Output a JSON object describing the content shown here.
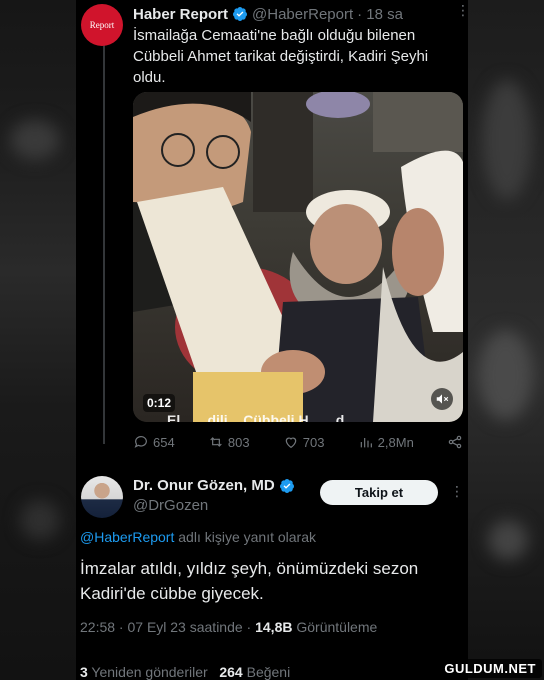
{
  "tweet": {
    "avatar_text": "Report",
    "name": "Haber Report",
    "handle": "@HaberReport",
    "time": "· 18 sa",
    "text": "İsmailağa Cemaati'ne bağlı olduğu bilenen Cübbeli Ahmet tarikat değiştirdi, Kadiri Şeyhi oldu.",
    "video": {
      "duration": "0:12",
      "subtitle": "El... ...dili... Cübbeli H... ...d"
    },
    "actions": {
      "replies": "654",
      "retweets": "803",
      "likes": "703",
      "views": "2,8Mn"
    }
  },
  "reply": {
    "name": "Dr. Onur Gözen, MD",
    "handle": "@DrGozen",
    "follow_label": "Takip et",
    "reply_to_link": "@HaberReport",
    "reply_to_suffix": " adlı kişiye yanıt olarak",
    "text": "İmzalar atıldı, yıldız şeyh, önümüzdeki sezon Kadiri'de cübbe giyecek.",
    "meta_time": "22:58 · 07 Eyl 23 saatinde · ",
    "meta_views_count": "14,8B",
    "meta_views_label": " Görüntüleme",
    "retweets_count": "3",
    "retweets_label": " Yeniden gönderiler",
    "likes_count": "264",
    "likes_label": " Beğeni"
  },
  "watermark": "GULDUM.NET",
  "colors": {
    "background": "#000000",
    "text": "#e7e9ea",
    "muted": "#71767b",
    "link": "#1d9bf0",
    "verified": "#1d9bf0",
    "report_red": "#d0142c"
  }
}
